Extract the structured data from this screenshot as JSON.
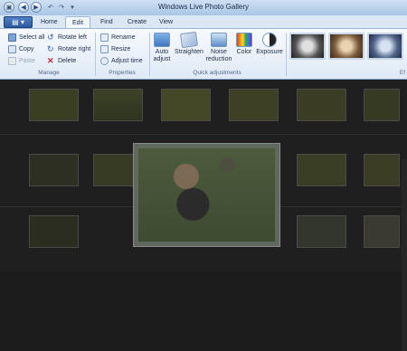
{
  "window": {
    "title": "Windows Live Photo Gallery"
  },
  "tabs": [
    {
      "label": "Home"
    },
    {
      "label": "Edit"
    },
    {
      "label": "Find"
    },
    {
      "label": "Create"
    },
    {
      "label": "View"
    }
  ],
  "ribbon": {
    "manage": {
      "label": "Manage",
      "select_all": "Select all",
      "copy": "Copy",
      "paste": "Paste",
      "rotate_left": "Rotate left",
      "rotate_right": "Rotate right",
      "delete": "Delete"
    },
    "properties": {
      "label": "Properties",
      "rename": "Rename",
      "resize": "Resize",
      "adjust_time": "Adjust time"
    },
    "quick_adjustments": {
      "label": "Quick adjustments",
      "auto_adjust": "Auto adjust",
      "straighten": "Straighten",
      "noise_reduction": "Noise reduction",
      "color": "Color",
      "exposure": "Exposure"
    },
    "effects": {
      "label": "Ef"
    }
  },
  "colors": {
    "ribbon_bg": "#e6eef8",
    "content_bg": "#1f1f1f",
    "accent": "#2c5aa0"
  }
}
